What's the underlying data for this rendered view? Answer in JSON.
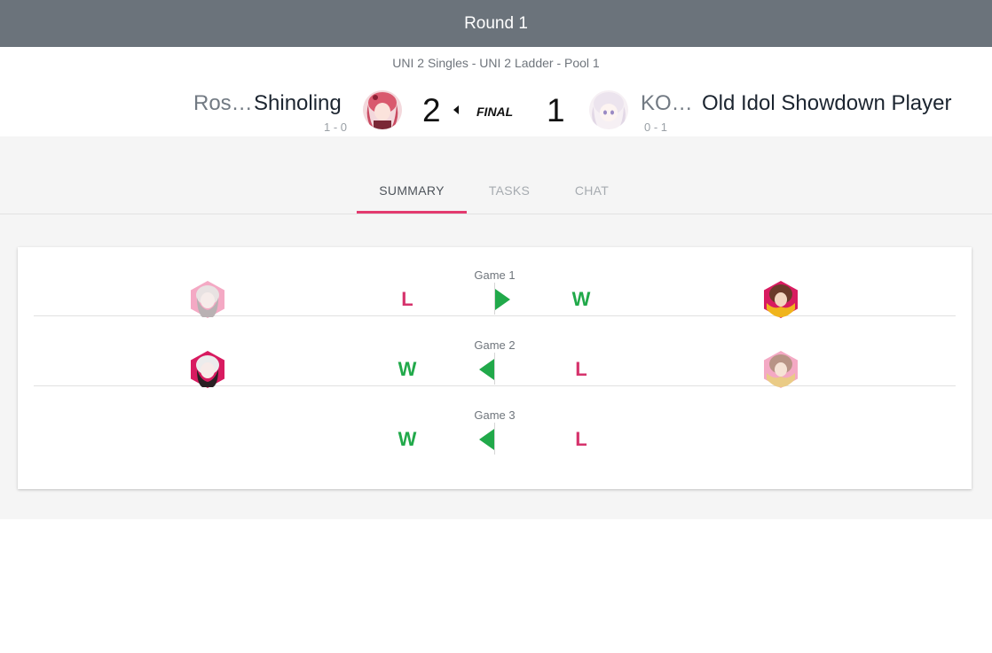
{
  "header": {
    "title": "Round 1"
  },
  "event": {
    "subtitle": "UNI 2 Singles - UNI 2 Ladder - Pool 1"
  },
  "match": {
    "left": {
      "tag": "Ros…",
      "name": "Shinoling",
      "record": "1 - 0",
      "score": "2"
    },
    "right": {
      "tag": "KO…",
      "name": "Old Idol Showdown Player",
      "record": "0 - 1",
      "score": "1"
    },
    "status": "FINAL"
  },
  "tabs": [
    {
      "label": "SUMMARY",
      "active": true
    },
    {
      "label": "TASKS",
      "active": false
    },
    {
      "label": "CHAT",
      "active": false
    }
  ],
  "games": [
    {
      "label": "Game 1",
      "left_result": "L",
      "right_result": "W",
      "winner": "right",
      "left_character_icon": "character-portrait-icon",
      "right_character_icon": "character-portrait-icon"
    },
    {
      "label": "Game 2",
      "left_result": "W",
      "right_result": "L",
      "winner": "left",
      "left_character_icon": "character-portrait-icon",
      "right_character_icon": "character-portrait-icon"
    },
    {
      "label": "Game 3",
      "left_result": "W",
      "right_result": "L",
      "winner": "left"
    }
  ],
  "colors": {
    "header_bg": "#6b737b",
    "win": "#21a94a",
    "loss": "#d6336c",
    "tab_accent": "#e33a6f",
    "page_gray": "#f5f5f5"
  }
}
